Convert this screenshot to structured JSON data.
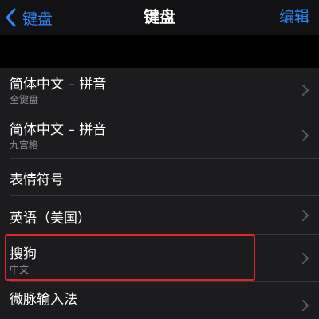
{
  "nav": {
    "back_label": "键盘",
    "title": "键盘",
    "edit_label": "编辑",
    "accent_color": "#2f86f6"
  },
  "keyboards": [
    {
      "title": "简体中文 – 拼音",
      "subtitle": "全键盘"
    },
    {
      "title": "简体中文 – 拼音",
      "subtitle": "九宫格"
    },
    {
      "title": "表情符号",
      "subtitle": ""
    },
    {
      "title": "英语（美国）",
      "subtitle": ""
    },
    {
      "title": "搜狗",
      "subtitle": "中文"
    },
    {
      "title": "微脉输入法",
      "subtitle": ""
    }
  ],
  "icons": {
    "back": "chevron-left-icon",
    "row_disclosure": "chevron-right-icon"
  },
  "annotation": {
    "highlight_color": "#e0252b",
    "highlighted_item": "搜狗"
  }
}
